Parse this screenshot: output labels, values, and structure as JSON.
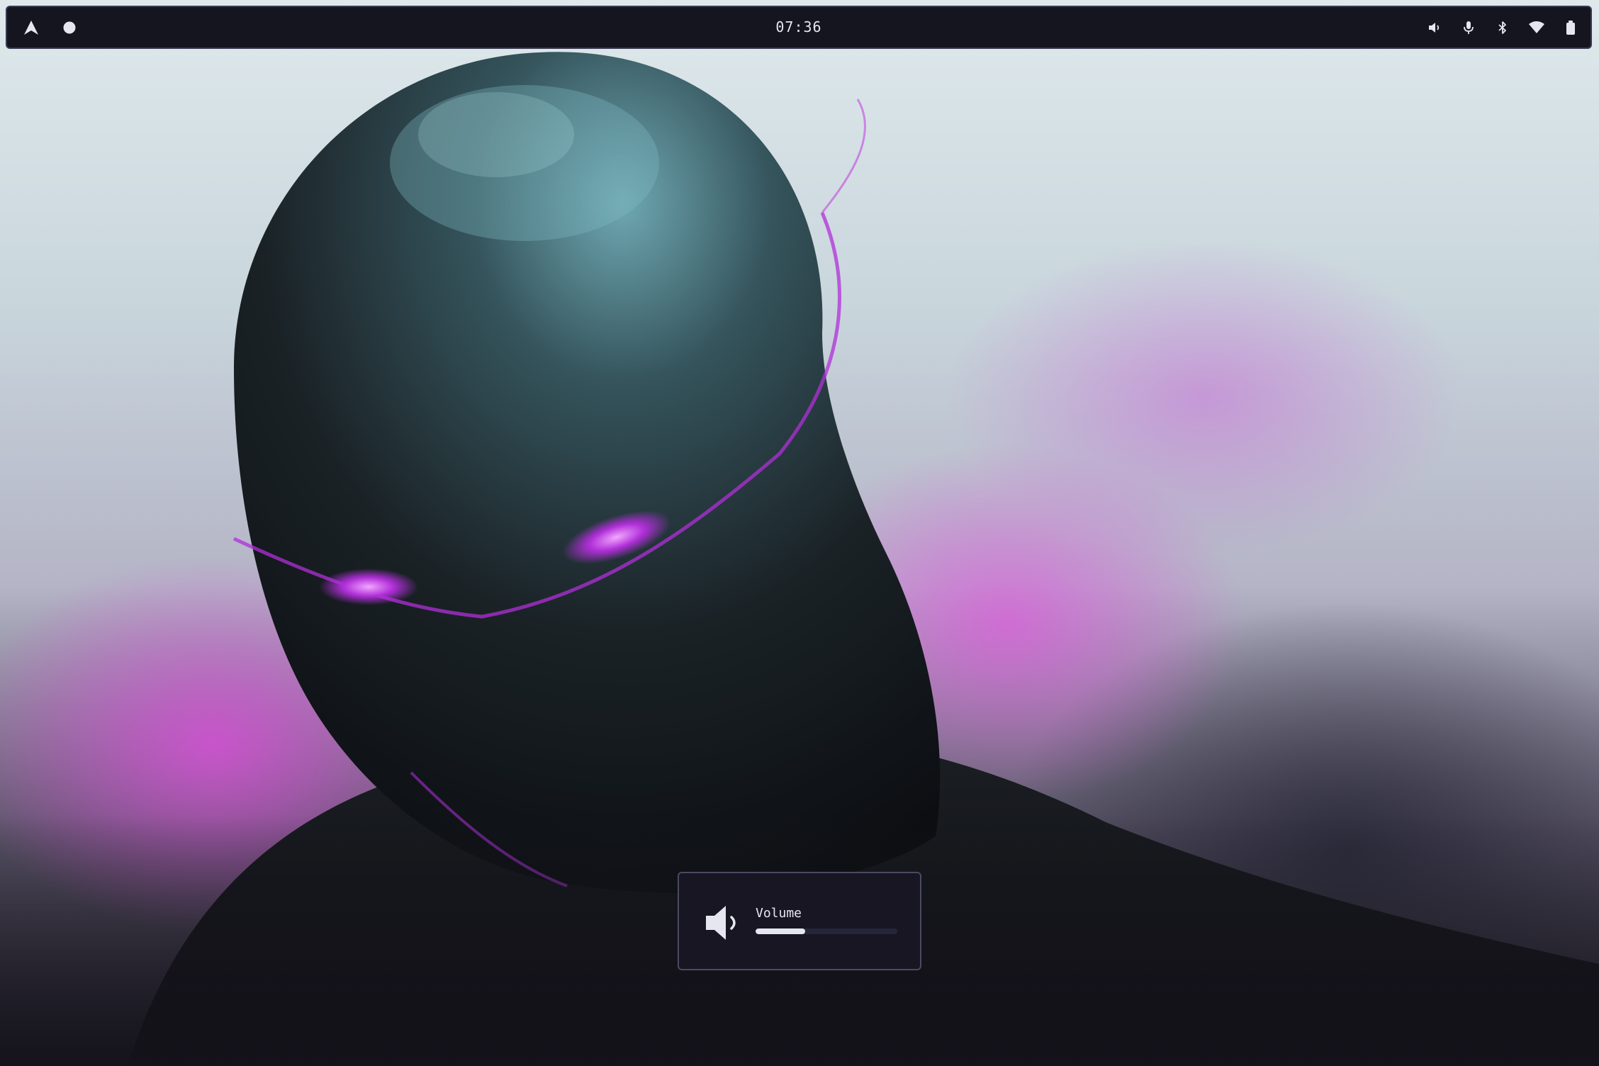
{
  "topbar": {
    "left_icons": [
      "arch-logo-icon",
      "workspace-dot-icon"
    ],
    "clock": "07:36",
    "tray_icons": [
      "volume-icon",
      "microphone-icon",
      "bluetooth-icon",
      "wifi-icon",
      "battery-icon"
    ]
  },
  "osd": {
    "label": "Volume",
    "icon": "speaker-icon",
    "level": 0.35
  },
  "colors": {
    "bar_bg": "#15151f",
    "bar_border": "#3a3a52",
    "text": "#e6e6f0",
    "accent_magenta": "#d64ed6"
  }
}
